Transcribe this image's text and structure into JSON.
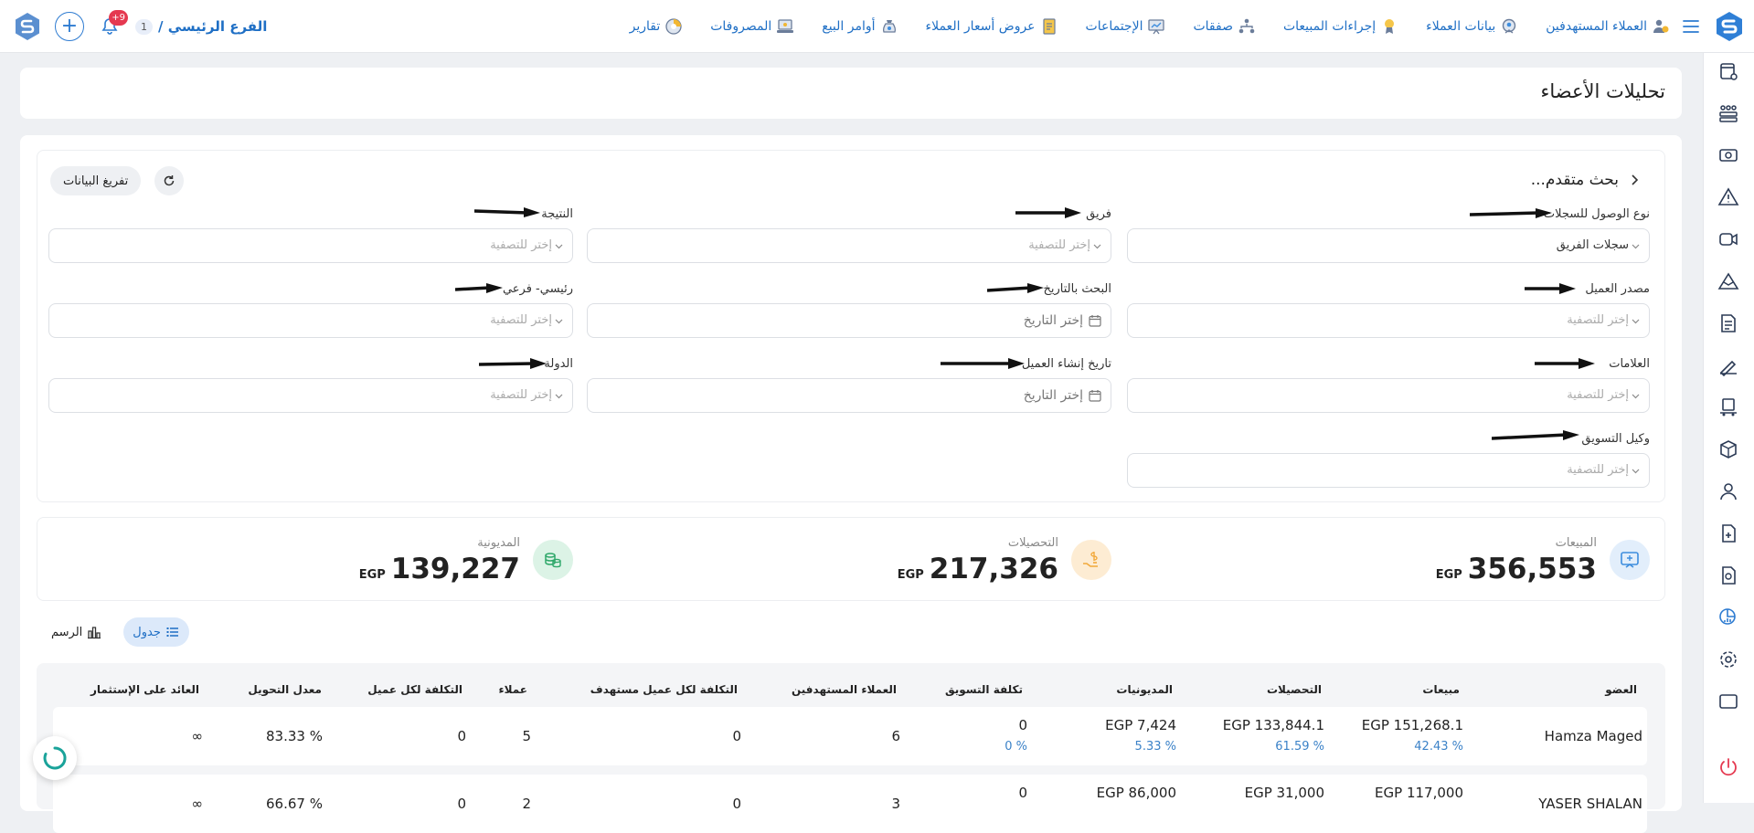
{
  "header": {
    "branch_name": "الفرع الرئيسي /",
    "branch_num": "1",
    "notification_count": "+9",
    "nav": [
      {
        "label": "العملاء المستهدفين",
        "icon": "target-customers-icon"
      },
      {
        "label": "بيانات العملاء",
        "icon": "customer-data-icon"
      },
      {
        "label": "إجراءات المبيعات",
        "icon": "sales-actions-icon"
      },
      {
        "label": "صفقات",
        "icon": "deals-icon"
      },
      {
        "label": "الإجتماعات",
        "icon": "meetings-icon"
      },
      {
        "label": "عروض أسعار العملاء",
        "icon": "quotations-icon"
      },
      {
        "label": "أوامر البيع",
        "icon": "sales-orders-icon"
      },
      {
        "label": "المصروفات",
        "icon": "expenses-icon"
      },
      {
        "label": "تقارير",
        "icon": "reports-icon"
      }
    ]
  },
  "page": {
    "title": "تحليلات الأعضاء"
  },
  "search": {
    "title": "بحث متقدم...",
    "clear_label": "تفريغ البيانات",
    "filters": {
      "access_type": {
        "label": "نوع الوصول للسجلات",
        "value": "سجلات الفريق"
      },
      "team": {
        "label": "فريق",
        "placeholder": "إختر للتصفية"
      },
      "result": {
        "label": "النتيجة",
        "placeholder": "إختر للتصفية"
      },
      "source": {
        "label": "مصدر العميل",
        "placeholder": "إختر للتصفية"
      },
      "date_search": {
        "label": "البحث بالتاريخ",
        "placeholder": "إختر التاريخ"
      },
      "main_sub": {
        "label": "رئيسي- فرعي",
        "placeholder": "إختر للتصفية"
      },
      "tags": {
        "label": "العلامات",
        "placeholder": "إختر للتصفية"
      },
      "created_date": {
        "label": "تاريخ إنشاء العميل",
        "placeholder": "إختر التاريخ"
      },
      "country": {
        "label": "الدولة",
        "placeholder": "إختر للتصفية"
      },
      "marketing_agent": {
        "label": "وكيل التسويق",
        "placeholder": "إختر للتصفية"
      }
    }
  },
  "stats": {
    "sales": {
      "label": "المبيعات",
      "currency": "EGP",
      "value": "356,553"
    },
    "collections": {
      "label": "التحصيلات",
      "currency": "EGP",
      "value": "217,326"
    },
    "debts": {
      "label": "المديونية",
      "currency": "EGP",
      "value": "139,227"
    }
  },
  "view_toggle": {
    "table": "جدول",
    "chart": "الرسم"
  },
  "table": {
    "headers": {
      "member": "العضو",
      "sales": "مبيعات",
      "collections": "التحصيلات",
      "debts": "المديونيات",
      "marketing_cost": "تكلفة التسويق",
      "targeted": "العملاء المستهدفين",
      "cost_per_target": "التكلفة لكل عميل مستهدف",
      "customers": "عملاء",
      "cost_per_customer": "التكلفة لكل عميل",
      "conversion": "معدل التحويل",
      "roi": "العائد على الإستثمار"
    },
    "rows": [
      {
        "member": "Hamza Maged",
        "sales": "EGP 151,268.1",
        "sales_pct": "% 42.43",
        "collections": "EGP 133,844.1",
        "collections_pct": "% 61.59",
        "debts": "EGP 7,424",
        "debts_pct": "% 5.33",
        "marketing_cost": "0",
        "marketing_pct": "% 0",
        "targeted": "6",
        "cost_per_target": "0",
        "customers": "5",
        "cost_per_customer": "0",
        "conversion": "% 83.33",
        "roi": "∞"
      },
      {
        "member": "YASER SHALAN",
        "sales": "EGP 117,000",
        "collections": "EGP 31,000",
        "debts": "EGP 86,000",
        "marketing_cost": "0",
        "targeted": "3",
        "cost_per_target": "0",
        "customers": "2",
        "cost_per_customer": "0",
        "conversion": "% 66.67",
        "roi": "∞"
      }
    ]
  }
}
